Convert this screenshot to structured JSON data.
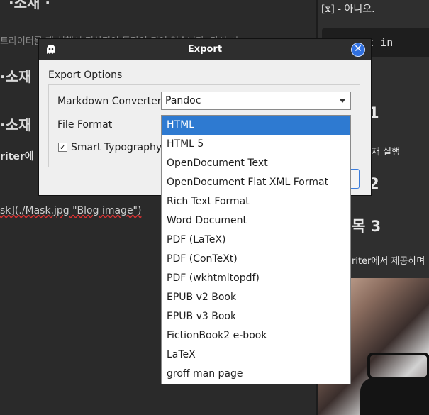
{
  "editor": {
    "heading_top": "·소재 ·",
    "faint_line": "트라이터를 재 실행시 정상적인 동작이 되어 있습니다. 다시 시",
    "subheading1": "·소재",
    "subheading2": "·소재",
    "writer_line": "riter에",
    "image_line": "sk](./Mask.jpg \"Blog image\")"
  },
  "preview": {
    "checkbox_line": "[x] - 아니오.",
    "code_line": "apt-get in",
    "num_1": "1",
    "rerun_line": "터를 재 실행",
    "num_2": "2",
    "heading_3": "목 3",
    "writer_line": "riter에서 제공하며"
  },
  "dialog": {
    "title": "Export",
    "group_title": "Export Options",
    "converter_label": "Markdown Converter",
    "converter_value": "Pandoc",
    "format_label": "File Format",
    "smart_label": "Smart Typography",
    "smart_checked": true,
    "check_mark": "✓",
    "close_symbol": "✕"
  },
  "dropdown": {
    "selected_index": 0,
    "options": [
      "HTML",
      "HTML 5",
      "OpenDocument Text",
      "OpenDocument Flat XML Format",
      "Rich Text Format",
      "Word Document",
      "PDF (LaTeX)",
      "PDF (ConTeXt)",
      "PDF (wkhtmltopdf)",
      "EPUB v2 Book",
      "EPUB v3 Book",
      "FictionBook2 e-book",
      "LaTeX",
      "groff man page"
    ]
  },
  "colors": {
    "accent": "#2e7ad1",
    "titlebar": "#2e2e2e",
    "dialog_bg": "#efefef"
  },
  "icons": [
    "app-ghost-icon",
    "close-icon",
    "dropdown-arrow-icon",
    "checkmark-icon"
  ]
}
